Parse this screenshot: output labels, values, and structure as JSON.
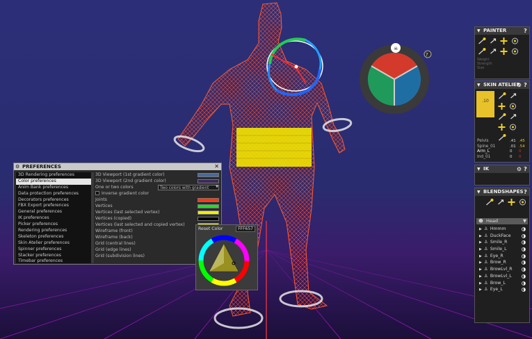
{
  "preferences": {
    "title": "PREFERENCES",
    "items": [
      "3D Rendering preferences",
      "Color preferences",
      "Anim Bank preferences",
      "Data protection preferences",
      "Decorators preferences",
      "FBX Export preferences",
      "General preferences",
      "IK preferences",
      "Picker preferences",
      "Rendering preferences",
      "Skeleton preferences",
      "Skin Atelier preferences",
      "Spinner preferences",
      "Stacker preferences",
      "Timebar preferences"
    ],
    "selected_index": 1,
    "rows": [
      {
        "label": "3D Viewport (1st gradient color)",
        "color": "#4a6a9a"
      },
      {
        "label": "3D Viewport (2nd gradient color)",
        "color": "#3a2a5a"
      },
      {
        "label": "One or two colors",
        "value": "Two colors with gradient"
      },
      {
        "label": "Inverse gradient color"
      },
      {
        "label": "Joints",
        "color": "#ff3a10"
      },
      {
        "label": "Vertices",
        "color": "#22dd22"
      },
      {
        "label": "Vertices (last selected vertex)",
        "color": "#f0f000"
      },
      {
        "label": "Vertices (copied)",
        "color": "#000000"
      },
      {
        "label": "Vertices (last selected and copied vertex)",
        "color": "#ffff44"
      },
      {
        "label": "Wireframe (front)",
        "color": "#ff6644"
      },
      {
        "label": "Wireframe (back)"
      },
      {
        "label": "Grid (central lines)"
      },
      {
        "label": "Grid (edge lines)"
      },
      {
        "label": "Grid (subdivision lines)"
      }
    ]
  },
  "color_picker": {
    "reset_label": "Reset Color",
    "hex_value": "FFF657"
  },
  "painter": {
    "title": "PAINTER",
    "fields": [
      "Weight",
      "Strength",
      "Size"
    ]
  },
  "skin_atelier": {
    "title": "SKIN ATELIER",
    "weight_value": ".10",
    "bones": [
      {
        "name": "Pelvis",
        "a": ".41",
        "b": ".45"
      },
      {
        "name": "Spine_01",
        "a": ".01",
        "b": ".54"
      },
      {
        "name": "Arm_L",
        "a": "0",
        "b": "0"
      },
      {
        "name": "Ind_01",
        "a": "0",
        "b": "0"
      }
    ]
  },
  "ik": {
    "title": "IK"
  },
  "blendshapes": {
    "title": "BLENDSHAPES",
    "group": "Head",
    "items": [
      "Hmmm",
      "DuckFace",
      "Smile_R",
      "Smile_L",
      "Eye_R",
      "Brow_R",
      "BrowLvl_R",
      "BrowLvl_L",
      "Brow_L",
      "Eye_L"
    ]
  },
  "colors": {
    "accent_red": "#d33a2c",
    "accent_green": "#1f9a5a",
    "accent_blue": "#1f6ea3"
  }
}
